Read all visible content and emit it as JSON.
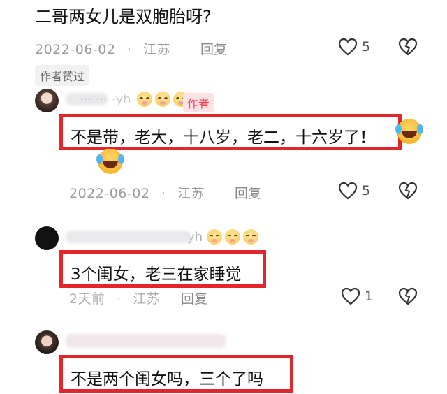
{
  "comment1": {
    "text": "二哥两女儿是双胞胎呀?",
    "date": "2022-06-02",
    "sep": "·",
    "location": "江苏",
    "reply": "回复",
    "likes": "5",
    "badge": "作者赞过"
  },
  "reply1": {
    "username": "··· ··· ·yh",
    "badge": "作者",
    "text": "不是带，老大，十八岁，老二，十六岁了！",
    "date": "2022-06-02",
    "sep": "·",
    "location": "江苏",
    "reply": "回复",
    "likes": "5"
  },
  "reply2": {
    "username": "yh",
    "text": "3个闺女，老三在家睡觉",
    "date": "2天前",
    "sep": "·",
    "location": "江苏",
    "reply": "回复",
    "likes": "1"
  },
  "reply3": {
    "text": "不是两个闺女吗，三个了吗"
  },
  "icons": {
    "like": "heart-outline-icon",
    "dislike": "broken-heart-icon",
    "laugh": "laughing-tears-emoji",
    "blush": "blushing-emoji"
  },
  "colors": {
    "highlight_border": "#e3262b",
    "author_badge_text": "#ff3b53",
    "meta_gray": "#9a9a9a"
  }
}
